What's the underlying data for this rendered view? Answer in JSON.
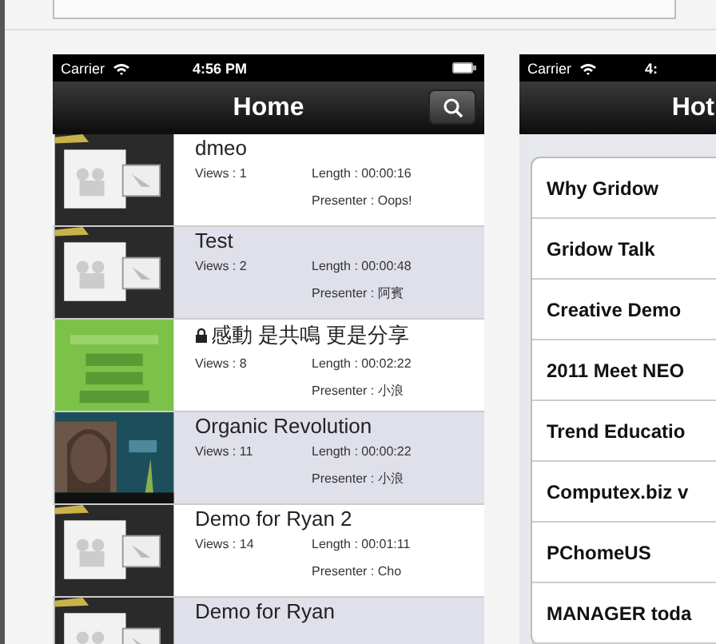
{
  "home_screen": {
    "status_bar": {
      "carrier": "Carrier",
      "time": "4:56 PM"
    },
    "title": "Home",
    "videos": [
      {
        "title": "dmeo",
        "locked": false,
        "views": "Views : 1",
        "length": "Length : 00:00:16",
        "presenter": "Presenter : Oops!"
      },
      {
        "title": "Test",
        "locked": false,
        "views": "Views : 2",
        "length": "Length : 00:00:48",
        "presenter": "Presenter : 阿賓"
      },
      {
        "title": "感動 是共鳴 更是分享",
        "locked": true,
        "views": "Views : 8",
        "length": "Length : 00:02:22",
        "presenter": "Presenter : 小浪"
      },
      {
        "title": "Organic Revolution",
        "locked": false,
        "views": "Views : 11",
        "length": "Length : 00:00:22",
        "presenter": "Presenter : 小浪"
      },
      {
        "title": "Demo for Ryan 2",
        "locked": false,
        "views": "Views : 14",
        "length": "Length : 00:01:11",
        "presenter": "Presenter : Cho"
      },
      {
        "title": "Demo for Ryan",
        "locked": false
      }
    ]
  },
  "hot_screen": {
    "status_bar": {
      "carrier": "Carrier",
      "time": "4:"
    },
    "title": "Hot",
    "items": [
      "Why Gridow",
      "Gridow Talk",
      "Creative Demo",
      "2011 Meet NEO",
      "Trend Educatio",
      "Computex.biz v",
      "PChomeUS",
      "MANAGER toda"
    ]
  }
}
